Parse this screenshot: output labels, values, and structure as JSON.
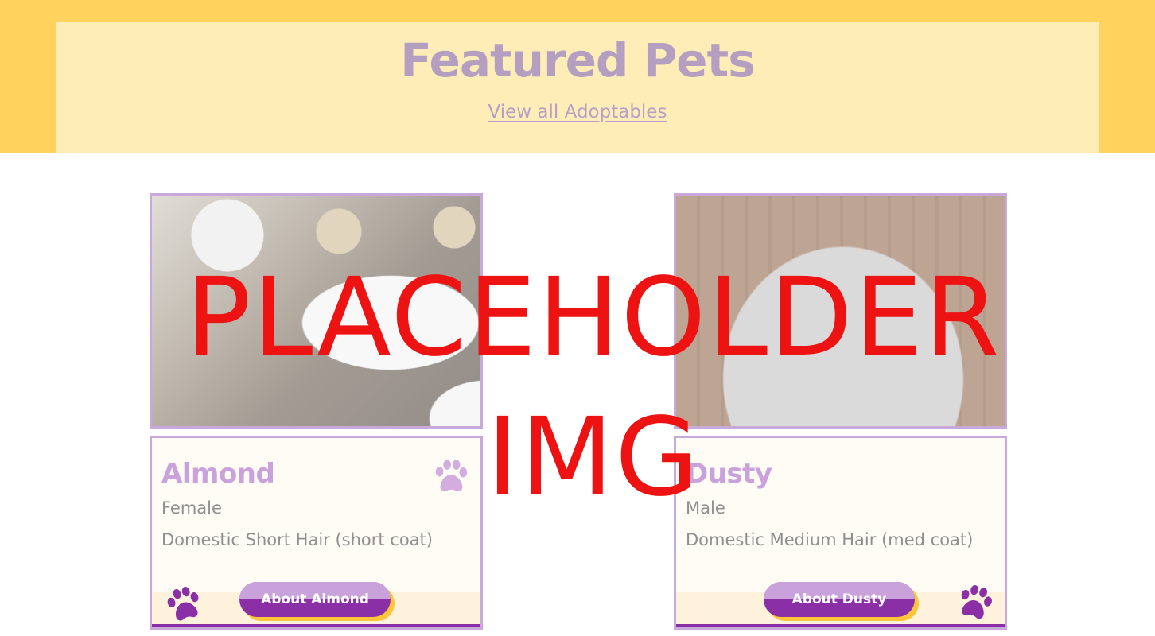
{
  "header": {
    "title": "Featured Pets",
    "link_label": "View all Adoptables"
  },
  "pets": [
    {
      "name": "Almond",
      "sex": "Female",
      "breed": "Domestic Short Hair (short coat)",
      "button_label": "About Almond"
    },
    {
      "name": "Dusty",
      "sex": "Male",
      "breed": "Domestic Medium Hair (med coat)",
      "button_label": "About Dusty"
    }
  ],
  "overlay": {
    "line1": "PLACEHOLDER",
    "line2": "IMG"
  },
  "icons": {
    "paw": "paw-print-icon"
  },
  "colors": {
    "band": "#ffd35e",
    "band_inner": "#ffedb8",
    "accent_purple": "#8a2fa5",
    "light_purple": "#c9a1db",
    "shadow_yellow": "#ffc53a",
    "overlay_red": "#ee1313"
  }
}
